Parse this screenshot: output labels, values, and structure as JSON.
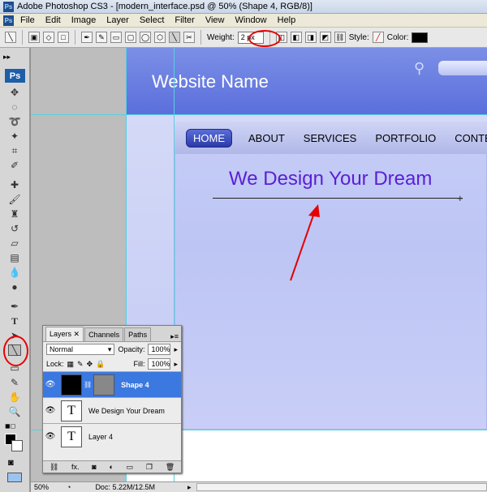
{
  "title_bar": {
    "text": "Adobe Photoshop CS3 - [modern_interface.psd @ 50% (Shape 4, RGB/8)]"
  },
  "menu": [
    "File",
    "Edit",
    "Image",
    "Layer",
    "Select",
    "Filter",
    "View",
    "Window",
    "Help"
  ],
  "options_bar": {
    "weight_label": "Weight:",
    "weight_value": "2 px",
    "style_label": "Style:",
    "color_label": "Color:"
  },
  "toolbar": {
    "logo": "Ps"
  },
  "website": {
    "name": "Website Name",
    "nav": [
      "HOME",
      "ABOUT",
      "SERVICES",
      "PORTFOLIO",
      "CONTECT"
    ],
    "headline": "We Design Your Dream"
  },
  "layers_panel": {
    "tabs": [
      "Layers",
      "Channels",
      "Paths"
    ],
    "blend_mode": "Normal",
    "opacity_label": "Opacity:",
    "opacity_value": "100%",
    "lock_label": "Lock:",
    "fill_label": "Fill:",
    "fill_value": "100%",
    "layers": [
      {
        "name": "Shape 4",
        "selected": true
      },
      {
        "name": "We Design Your Dream",
        "selected": false
      },
      {
        "name": "Layer 4",
        "selected": false
      }
    ],
    "footer_text": "fx."
  },
  "status_bar": {
    "zoom": "50%",
    "doc": "Doc: 5.22M/12.5M"
  },
  "colors": {
    "accent_red": "#e60000",
    "header_blue": "#6b7fe2",
    "headline_purple": "#5a1fd6",
    "selected_layer": "#3b78e0"
  }
}
